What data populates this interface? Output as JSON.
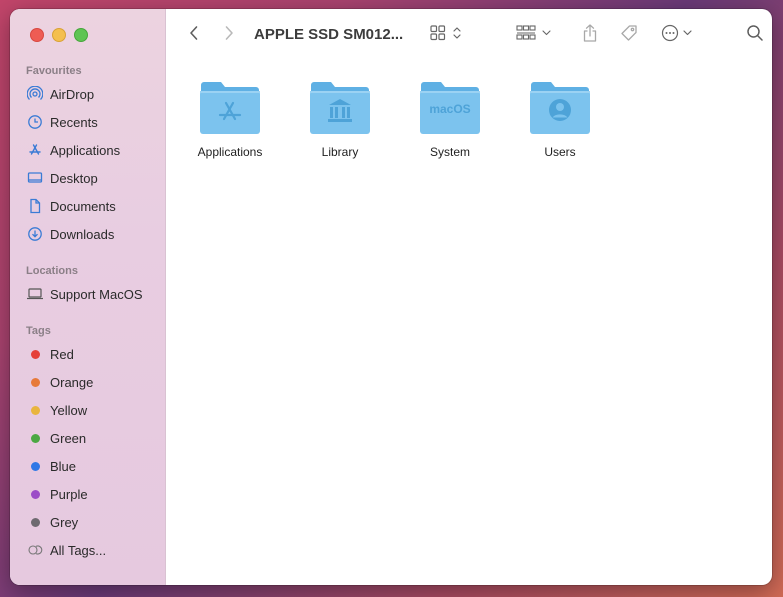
{
  "window": {
    "title": "APPLE SSD SM012..."
  },
  "sidebar": {
    "favourites_title": "Favourites",
    "favourites": [
      {
        "label": "AirDrop",
        "icon": "airdrop-icon"
      },
      {
        "label": "Recents",
        "icon": "clock-icon"
      },
      {
        "label": "Applications",
        "icon": "applications-icon"
      },
      {
        "label": "Desktop",
        "icon": "desktop-icon"
      },
      {
        "label": "Documents",
        "icon": "document-icon"
      },
      {
        "label": "Downloads",
        "icon": "download-icon"
      }
    ],
    "locations_title": "Locations",
    "locations": [
      {
        "label": "Support MacOS",
        "icon": "laptop-icon"
      }
    ],
    "tags_title": "Tags",
    "tags": [
      {
        "label": "Red",
        "color": "#e5403a"
      },
      {
        "label": "Orange",
        "color": "#e77a3a"
      },
      {
        "label": "Yellow",
        "color": "#e9b53f"
      },
      {
        "label": "Green",
        "color": "#4ba843"
      },
      {
        "label": "Blue",
        "color": "#2f78e6"
      },
      {
        "label": "Purple",
        "color": "#9c4dc7"
      },
      {
        "label": "Grey",
        "color": "#6e6a70"
      },
      {
        "label": "All Tags...",
        "color": ""
      }
    ]
  },
  "content": {
    "items": [
      {
        "label": "Applications",
        "emblem": "A"
      },
      {
        "label": "Library",
        "emblem": "columns"
      },
      {
        "label": "System",
        "emblem": "macOS"
      },
      {
        "label": "Users",
        "emblem": "user"
      }
    ]
  },
  "colors": {
    "accent": "#3a7bd5",
    "folder": "#7cc3ee"
  }
}
